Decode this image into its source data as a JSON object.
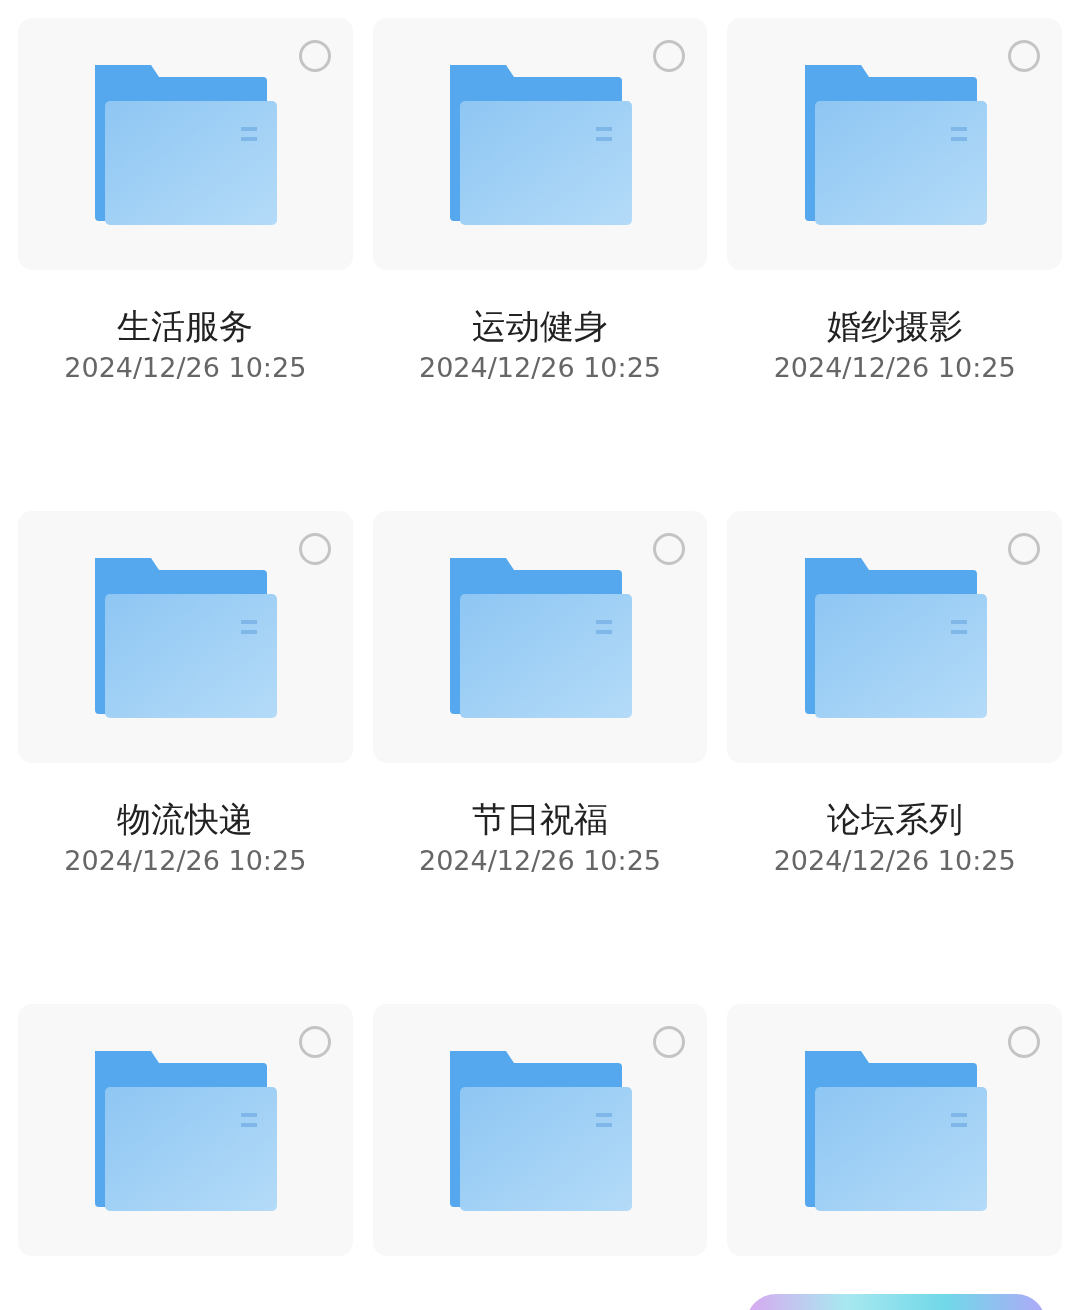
{
  "folders": [
    {
      "name": "生活服务",
      "modified": "2024/12/26 10:25",
      "selected": false
    },
    {
      "name": "运动健身",
      "modified": "2024/12/26 10:25",
      "selected": false
    },
    {
      "name": "婚纱摄影",
      "modified": "2024/12/26 10:25",
      "selected": false
    },
    {
      "name": "物流快递",
      "modified": "2024/12/26 10:25",
      "selected": false
    },
    {
      "name": "节日祝福",
      "modified": "2024/12/26 10:25",
      "selected": false
    },
    {
      "name": "论坛系列",
      "modified": "2024/12/26 10:25",
      "selected": false
    },
    {
      "selected": false
    },
    {
      "selected": false
    },
    {
      "selected": false
    }
  ]
}
